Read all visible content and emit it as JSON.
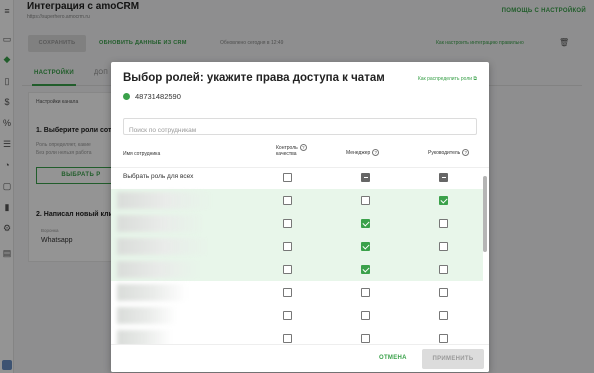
{
  "header": {
    "title": "Интеграция с amoCRM",
    "url": "https://superhero.amocrm.ru",
    "help_link": "ПОМОЩЬ С НАСТРОЙКОЙ"
  },
  "toolbar": {
    "save_label": "СОХРАНИТЬ",
    "update_label": "ОБНОВИТЬ ДАННЫЕ ИЗ CRM",
    "updated_text": "Обновлено сегодня в 12:49",
    "how_link": "Как настроить интеграцию правильно",
    "trash_icon": "trash-icon"
  },
  "tabs": [
    {
      "label": "НАСТРОЙКИ",
      "active": true
    },
    {
      "label": "ДОП",
      "active": false
    }
  ],
  "settings_panel": {
    "channel_label": "Настройки канала",
    "step1_title": "1. Выберите роли сотр",
    "step1_desc_1": "Роль определяет, какие",
    "step1_desc_2": "Без роли нельзя работа",
    "pick_button": "ВЫБРАТЬ Р",
    "step2_title": "2. Написал новый кли",
    "funnel_label": "Воронка",
    "funnel_value": "Whatsapp"
  },
  "modal": {
    "title": "Выбор ролей: укажите права доступа к чатам",
    "how_link": "Как распределить роли",
    "phone": "48731482590",
    "search_placeholder": "Поиск по сотрудникам",
    "columns": {
      "name": "Имя сотрудника",
      "quality_line1": "Контроль",
      "quality_line2": "качества",
      "manager": "Менеджер",
      "head": "Руководитель"
    },
    "select_all_label": "Выбрать роль для всех",
    "select_all": {
      "quality": "empty",
      "manager": "indeterminate",
      "head": "indeterminate"
    },
    "rows": [
      {
        "highlight": true,
        "quality": false,
        "manager": false,
        "head": true
      },
      {
        "highlight": true,
        "quality": false,
        "manager": true,
        "head": false
      },
      {
        "highlight": true,
        "quality": false,
        "manager": true,
        "head": false
      },
      {
        "highlight": true,
        "quality": false,
        "manager": true,
        "head": false
      },
      {
        "highlight": false,
        "quality": false,
        "manager": false,
        "head": false
      },
      {
        "highlight": false,
        "quality": false,
        "manager": false,
        "head": false
      },
      {
        "highlight": false,
        "quality": false,
        "manager": false,
        "head": false
      }
    ],
    "cancel_label": "ОТМЕНА",
    "apply_label": "ПРИМЕНИТЬ"
  },
  "colors": {
    "accent": "#3aa14a",
    "highlight_row": "#e8f6ea"
  }
}
